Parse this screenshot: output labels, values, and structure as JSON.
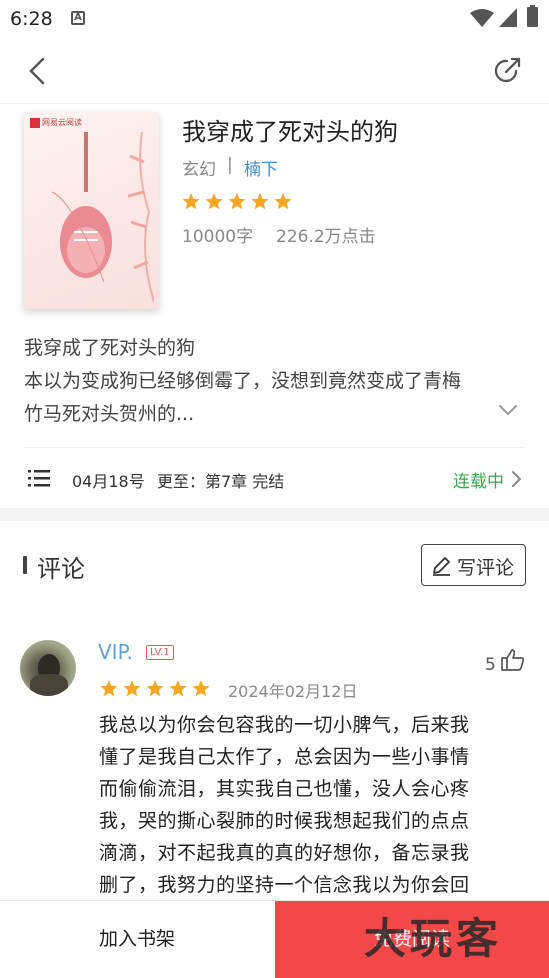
{
  "status_bar": {
    "time": "6:28",
    "notification_icon": "A"
  },
  "top_bar": {
    "back_icon": "back-arrow",
    "share_icon": "share-external"
  },
  "book": {
    "title": "我穿成了死对头的狗",
    "genre": "玄幻",
    "separator": "|",
    "author": "楠下",
    "rating": 5,
    "word_count": "10000字",
    "clicks": "226.2万点击",
    "cover_publisher": "网易云阅读"
  },
  "description": {
    "lines": [
      "我穿成了死对头的狗",
      "本以为变成狗已经够倒霉了，没想到竟然变成了青梅",
      "竹马死对头贺州的..."
    ]
  },
  "chapter": {
    "update_date": "04月18号",
    "update_info": "更至：第7章 完结",
    "status": "连载中"
  },
  "comments_section": {
    "title": "评论",
    "write_button": "写评论",
    "comment": {
      "username": "VIP.",
      "level": "LV.1",
      "likes": "5",
      "rating": 5,
      "date": "2024年02月12日",
      "lines": [
        "我总以为你会包容我的一切小脾气，后来我",
        "懂了是我自己太作了，总会因为一些小事情",
        "而偷偷流泪，其实我自己也懂，没人会心疼",
        "我，哭的撕心裂肺的时候我想起我们的点点",
        "滴滴，对不起我真的真的好想你，备忘录我",
        "删了，我努力的坚持一个信念我以为你会回"
      ]
    }
  },
  "bottom_bar": {
    "add_shelf": "加入书架",
    "free_read": "免费阅读"
  },
  "watermark": "大玩客",
  "colors": {
    "accent_red": "#f24848",
    "star": "#f5a623",
    "link_blue": "#3d8fd8",
    "status_green": "#3aa84a"
  }
}
